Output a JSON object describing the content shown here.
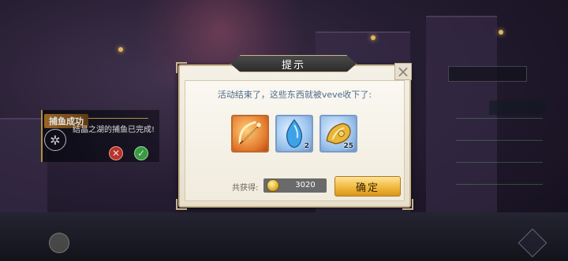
{
  "dialog": {
    "title": "提示",
    "message": "活动结束了，这些东西就被veve收下了:",
    "items": [
      {
        "icon": "bow-weapon-icon",
        "qty": ""
      },
      {
        "icon": "blue-crystal-icon",
        "qty": "2"
      },
      {
        "icon": "golden-shell-icon",
        "qty": "25"
      }
    ],
    "total_label": "共获得:",
    "total_value": "3020",
    "confirm_label": "确定"
  },
  "notification": {
    "title": "捕鱼成功",
    "message": "结晶之湖的捕鱼已完成!"
  },
  "colors": {
    "dialog_bg": "#f4f0e6",
    "message_text": "#4e6a8a",
    "confirm_btn": "#f0b93c",
    "cancel_btn": "#d63a2e",
    "ok_btn": "#3fb04a"
  }
}
